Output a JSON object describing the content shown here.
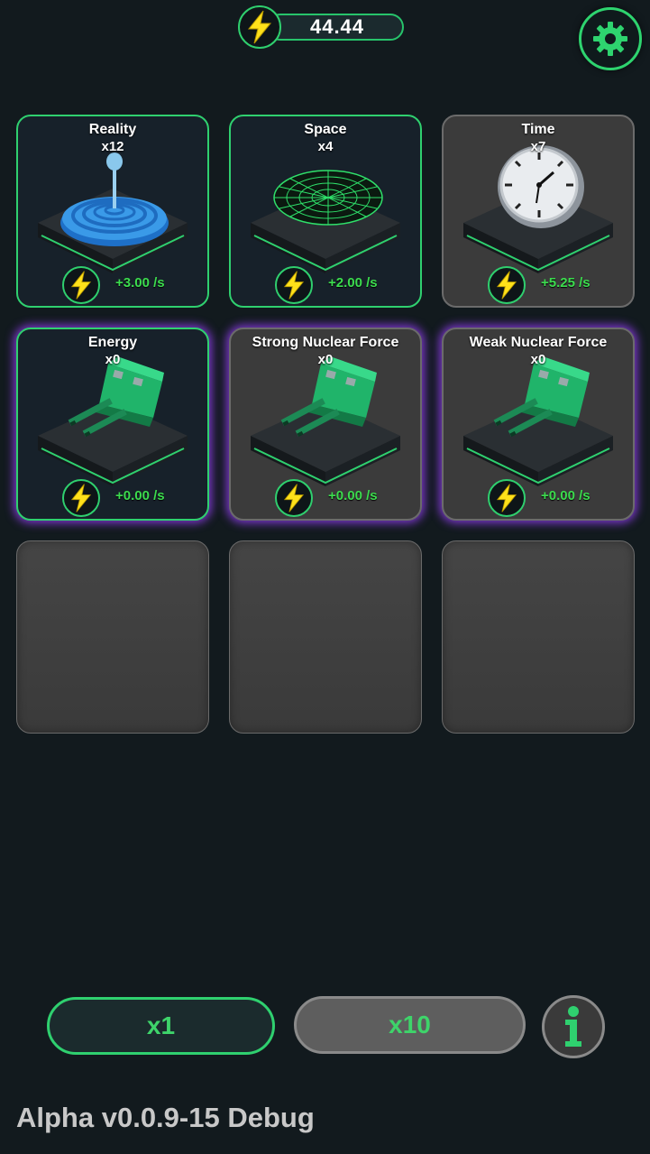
{
  "header": {
    "energy_value": "44.44",
    "energy_icon": "lightning-bolt-icon",
    "settings_icon": "gear-icon"
  },
  "cards": [
    {
      "name": "Reality",
      "count": "x12",
      "rate": "+3.00 /s",
      "state": "unlocked",
      "art": "reality-ripple-icon"
    },
    {
      "name": "Space",
      "count": "x4",
      "rate": "+2.00 /s",
      "state": "unlocked",
      "art": "space-grid-icon"
    },
    {
      "name": "Time",
      "count": "x7",
      "rate": "+5.25 /s",
      "state": "locked",
      "art": "clock-icon"
    },
    {
      "name": "Energy",
      "count": "x0",
      "rate": "+0.00 /s",
      "state": "unlocked-purple",
      "art": "green-turret-icon"
    },
    {
      "name": "Strong Nuclear Force",
      "count": "x0",
      "rate": "+0.00 /s",
      "state": "locked-purple",
      "art": "green-turret-icon"
    },
    {
      "name": "Weak Nuclear Force",
      "count": "x0",
      "rate": "+0.00 /s",
      "state": "locked-purple",
      "art": "green-turret-icon"
    }
  ],
  "footer": {
    "x1_label": "x1",
    "x10_label": "x10",
    "info_icon": "info-icon",
    "version": "Alpha v0.0.9-15 Debug"
  },
  "colors": {
    "background": "#121a1e",
    "accent_green": "#2fd06f",
    "rate_green": "#3cdc4e",
    "bolt_yellow": "#ffe11a",
    "purple_glow": "#8c3ce6"
  }
}
